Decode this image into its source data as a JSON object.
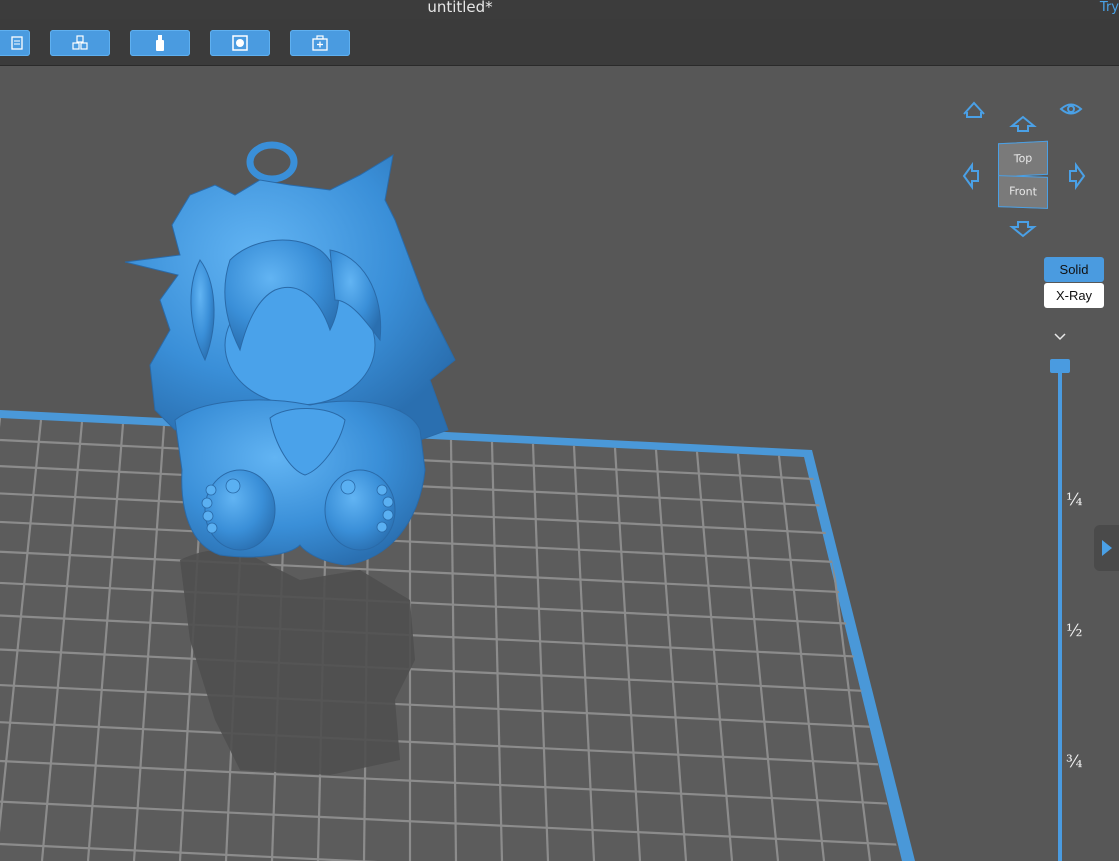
{
  "window": {
    "title": "untitled*",
    "try_label": "Try"
  },
  "toolbar": {
    "buttons": [
      {
        "icon": "file-icon"
      },
      {
        "icon": "models-icon"
      },
      {
        "icon": "support-icon"
      },
      {
        "icon": "hollow-icon"
      },
      {
        "icon": "add-icon"
      }
    ]
  },
  "view_cube": {
    "top_label": "Top",
    "front_label": "Front"
  },
  "nav": {
    "home": "home-icon",
    "eye": "eye-icon",
    "up": "arrow-up-icon",
    "down": "arrow-down-icon",
    "left": "arrow-left-icon",
    "right": "arrow-right-icon"
  },
  "render_mode": {
    "solid_label": "Solid",
    "xray_label": "X-Ray",
    "active": "Solid"
  },
  "layer_slider": {
    "ticks": [
      "¼",
      "½",
      "¾"
    ]
  },
  "colors": {
    "accent": "#4a9be0",
    "model": "#3a8fd8",
    "viewport": "#575757",
    "grid_line": "#8a8a8a",
    "platform": "#5a5a5a"
  }
}
